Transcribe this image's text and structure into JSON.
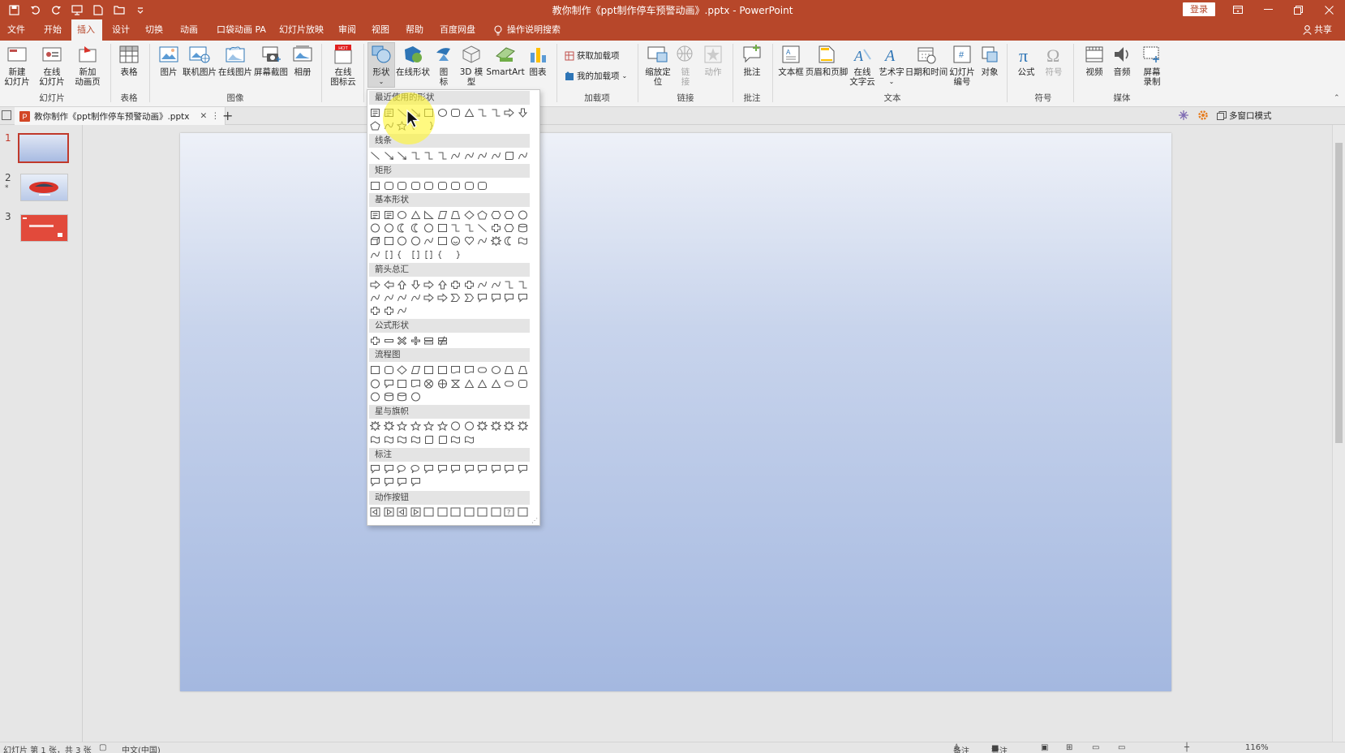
{
  "app": {
    "title": "教你制作《ppt制作停车预警动画》.pptx  -  PowerPoint",
    "login": "登录",
    "share": "共享"
  },
  "menu": {
    "tabs": [
      "文件",
      "开始",
      "插入",
      "设计",
      "切换",
      "动画",
      "口袋动画 PA",
      "幻灯片放映",
      "审阅",
      "视图",
      "帮助",
      "百度网盘",
      "操作说明搜索"
    ],
    "active": "插入"
  },
  "ribbon": {
    "buttons": {
      "new_slide": "新建\n幻灯片",
      "online_slide": "在线\n幻灯片",
      "new_anim_page": "新加\n动画页",
      "table": "表格",
      "picture": "图片",
      "online_picture": "联机图片",
      "online_image": "在线图片",
      "screenshot": "屏幕截图",
      "album": "相册",
      "online_icon_cloud": "在线\n图标云",
      "shapes": "形状",
      "online_shapes": "在线形状",
      "icons": "图\n标",
      "model3d": "3D 模\n型",
      "smartart": "SmartArt",
      "chart": "图表",
      "get_addins": "获取加载项",
      "my_addins": "我的加载项",
      "zoom": "缩放定\n位",
      "link": "链\n接",
      "action": "动作",
      "comment": "批注",
      "textbox": "文本框",
      "header_footer": "页眉和页脚",
      "online_text_cloud": "在线\n文字云",
      "wordart": "艺术字",
      "date_time": "日期和时间",
      "slide_number": "幻灯片\n编号",
      "object": "对象",
      "equation": "公式",
      "symbol": "符号",
      "video": "视频",
      "audio": "音频",
      "screen_record": "屏幕\n录制"
    },
    "groups": {
      "slides": "幻灯片",
      "tables": "表格",
      "images": "图像",
      "addins": "加载项",
      "links": "链接",
      "comments": "批注",
      "text": "文本",
      "symbols": "符号",
      "media": "媒体"
    }
  },
  "document_tab": {
    "label": "教你制作《ppt制作停车预警动画》.pptx",
    "right_label": "多窗口模式"
  },
  "slides": [
    {
      "number": "1",
      "selected": true
    },
    {
      "number": "2",
      "selected": false
    },
    {
      "number": "3",
      "selected": false
    }
  ],
  "shapes_menu": {
    "sections": [
      "最近使用的形状",
      "线条",
      "矩形",
      "基本形状",
      "箭头总汇",
      "公式形状",
      "流程图",
      "星与旗帜",
      "标注",
      "动作按钮"
    ]
  },
  "status": {
    "slide_info": "幻灯片 第 1 张，共 3 张",
    "language": "中文(中国)",
    "notes": "备注",
    "comments": "批注",
    "zoom": "116%"
  },
  "colors": {
    "brand": "#b7472a",
    "selection": "#c0392b",
    "highlight": "#fff532"
  }
}
